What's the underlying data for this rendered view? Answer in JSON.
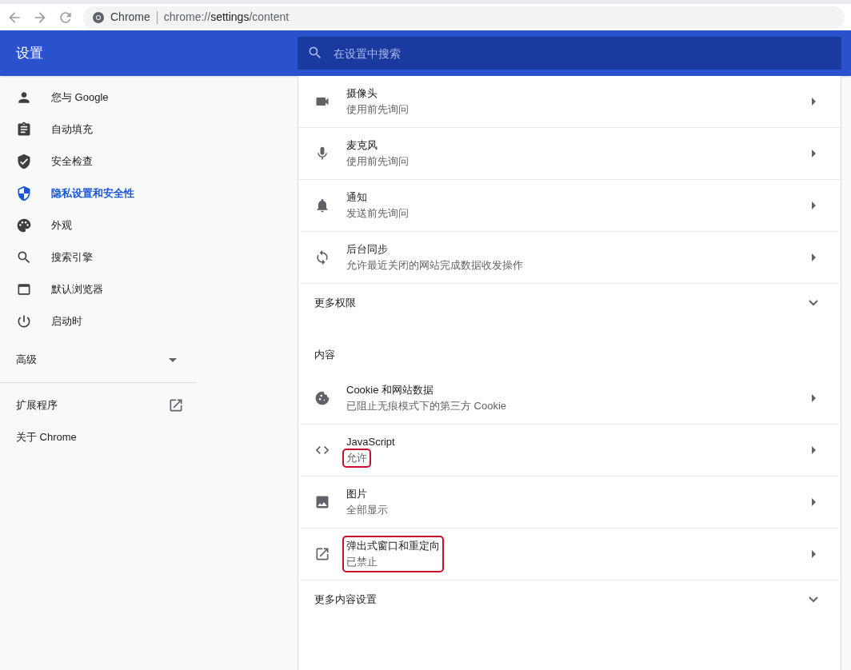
{
  "address_bar": {
    "site_label": "Chrome",
    "url_scheme": "chrome://",
    "url_host": "settings",
    "url_path": "/content"
  },
  "header": {
    "title": "设置",
    "search": {
      "placeholder": "在设置中搜索"
    }
  },
  "sidebar": {
    "items": [
      {
        "label": "您与 Google",
        "selected": false
      },
      {
        "label": "自动填充",
        "selected": false
      },
      {
        "label": "安全检查",
        "selected": false
      },
      {
        "label": "隐私设置和安全性",
        "selected": true
      },
      {
        "label": "外观",
        "selected": false
      },
      {
        "label": "搜索引擎",
        "selected": false
      },
      {
        "label": "默认浏览器",
        "selected": false
      },
      {
        "label": "启动时",
        "selected": false
      }
    ],
    "advanced": {
      "label": "高级",
      "expanded": false
    },
    "links": [
      {
        "label": "扩展程序"
      },
      {
        "label": "关于 Chrome"
      }
    ]
  },
  "groups": [
    {
      "rows": [
        {
          "title": "摄像头",
          "subtitle": "使用前先询问",
          "title_highlighted": false,
          "subtitle_highlighted": false
        },
        {
          "title": "麦克风",
          "subtitle": "使用前先询问",
          "title_highlighted": false,
          "subtitle_highlighted": false
        },
        {
          "title": "通知",
          "subtitle": "发送前先询问",
          "title_highlighted": false,
          "subtitle_highlighted": false
        },
        {
          "title": "后台同步",
          "subtitle": "允许最近关闭的网站完成数据收发操作",
          "title_highlighted": false,
          "subtitle_highlighted": false
        }
      ],
      "more": {
        "label": "更多权限",
        "expanded": false
      }
    },
    {
      "heading": "内容",
      "rows": [
        {
          "title": "Cookie 和网站数据",
          "subtitle": "已阻止无痕模式下的第三方 Cookie",
          "title_highlighted": false,
          "subtitle_highlighted": false
        },
        {
          "title": "JavaScript",
          "subtitle": "允许",
          "title_highlighted": false,
          "subtitle_highlighted": true
        },
        {
          "title": "图片",
          "subtitle": "全部显示",
          "title_highlighted": false,
          "subtitle_highlighted": false
        },
        {
          "title": "弹出式窗口和重定向",
          "subtitle": "已禁止",
          "title_highlighted": true,
          "subtitle_highlighted": true
        }
      ],
      "more": {
        "label": "更多内容设置",
        "expanded": false
      }
    }
  ]
}
